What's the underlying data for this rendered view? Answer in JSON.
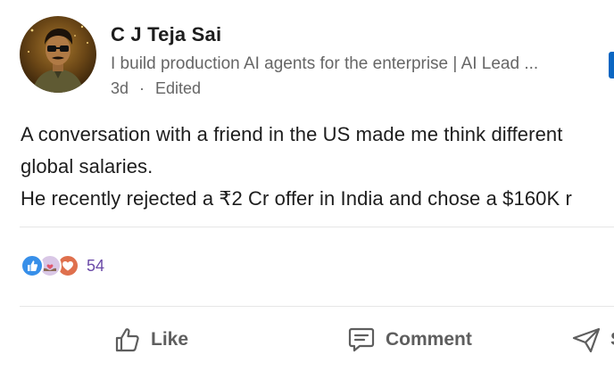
{
  "post": {
    "author": {
      "name": "C J Teja Sai",
      "headline": "I build production AI agents for the enterprise | AI Lead ...",
      "time": "3d",
      "separator": "·",
      "edited": "Edited"
    },
    "body_lines": [
      "A conversation with a friend in the US made me think different",
      "global salaries.",
      "He recently rejected a ₹2 Cr offer in India and chose a $160K r"
    ],
    "reactions": {
      "icons": [
        "like-icon",
        "support-icon",
        "love-icon"
      ],
      "count": "54"
    },
    "actions": {
      "like": "Like",
      "comment": "Comment",
      "send": "S"
    }
  },
  "colors": {
    "link_blue": "#0a66c2",
    "reaction_count": "#6b4aa8",
    "text_primary": "#1d1d1d",
    "text_secondary": "#666666"
  }
}
